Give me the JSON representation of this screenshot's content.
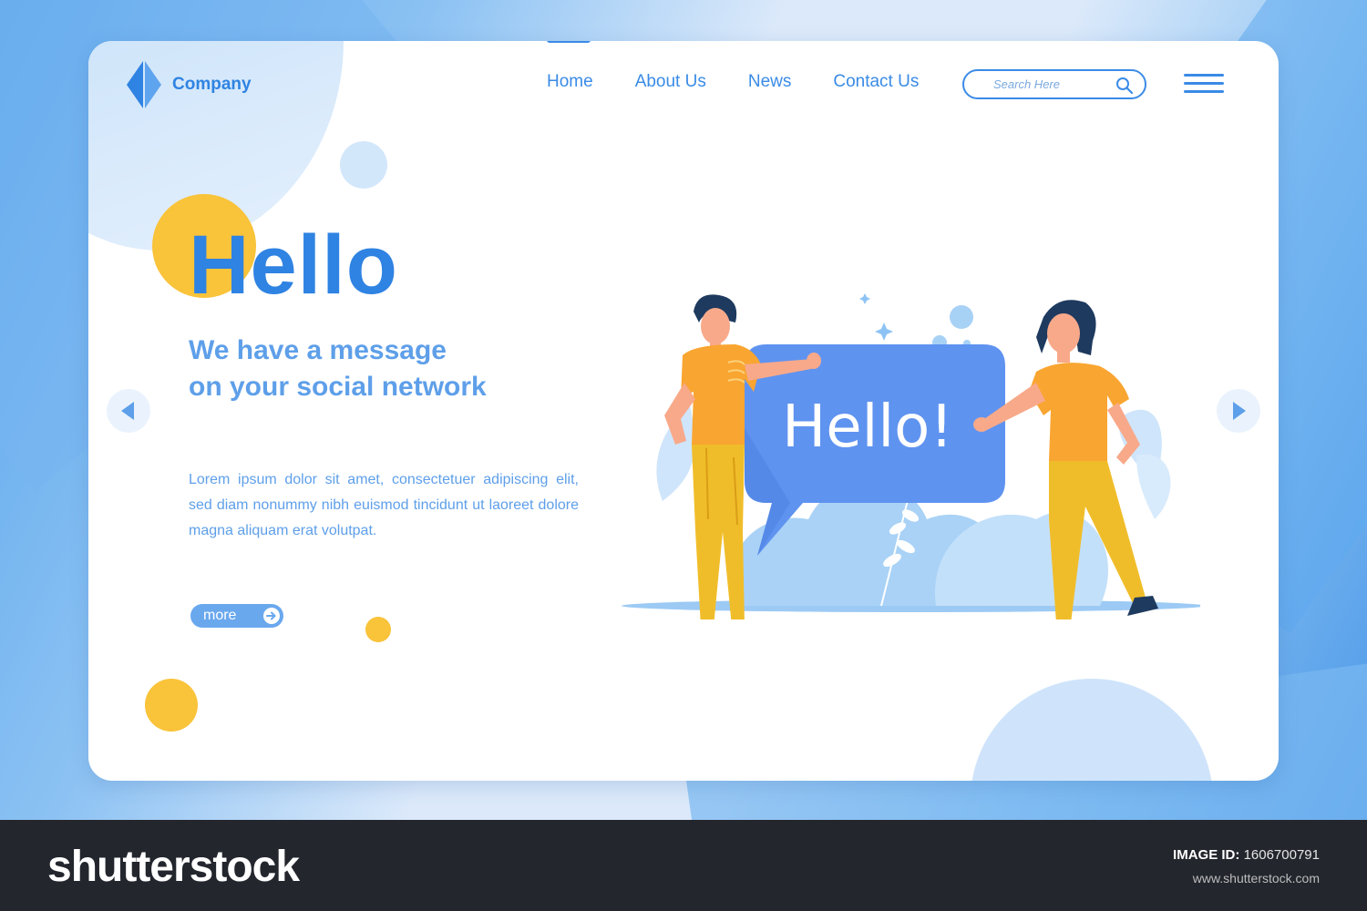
{
  "header": {
    "company_name": "Company",
    "nav": [
      {
        "label": "Home"
      },
      {
        "label": "About Us"
      },
      {
        "label": "News"
      },
      {
        "label": "Contact Us"
      }
    ],
    "search_placeholder": "Search Here"
  },
  "hero": {
    "title": "Hello",
    "subtitle_line1": "We have a message",
    "subtitle_line2": "on your social network",
    "body": "Lorem ipsum dolor sit amet, consectetuer adipiscing elit, sed diam nonummy nibh euismod tincidunt ut laoreet dolore magna aliquam erat volutpat.",
    "cta_label": "more"
  },
  "illustration": {
    "speech_bubble_text": "Hello!"
  },
  "footer": {
    "brand": "shutterstock",
    "image_id_label": "IMAGE ID:",
    "image_id_value": "1606700791",
    "site": "www.shutterstock.com"
  },
  "colors": {
    "primary": "#2f83e2",
    "accent_yellow": "#f9c33a",
    "speech_bubble": "#5f93f0",
    "shirt_orange": "#f9a531",
    "pants_yellow": "#f0bd2a"
  },
  "icons": [
    "logo-mark-icon",
    "search-icon",
    "hamburger-menu-icon",
    "arrow-right-icon",
    "chevron-left-icon",
    "chevron-right-icon"
  ]
}
